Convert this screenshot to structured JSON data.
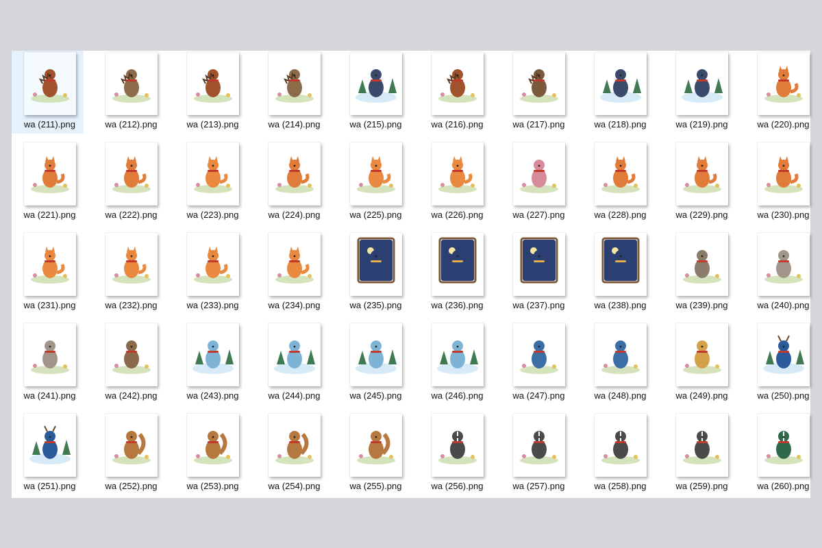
{
  "explorer": {
    "selected_index": 0,
    "files": [
      {
        "name": "wa (211).png",
        "icon": "hedgehog-icon",
        "color": "#a0522d"
      },
      {
        "name": "wa (212).png",
        "icon": "hedgehog-icon",
        "color": "#8b6b4a"
      },
      {
        "name": "wa (213).png",
        "icon": "hedgehog-icon",
        "color": "#a0522d"
      },
      {
        "name": "wa (214).png",
        "icon": "hedgehog-icon",
        "color": "#8b6b4a"
      },
      {
        "name": "wa (215).png",
        "icon": "penguin-icon",
        "color": "#3a4a6b"
      },
      {
        "name": "wa (216).png",
        "icon": "hedgehog-icon",
        "color": "#a0522d"
      },
      {
        "name": "wa (217).png",
        "icon": "hedgehog-icon",
        "color": "#7a5a3a"
      },
      {
        "name": "wa (218).png",
        "icon": "penguin-icon",
        "color": "#3a4a6b"
      },
      {
        "name": "wa (219).png",
        "icon": "penguin-icon",
        "color": "#3a4a6b"
      },
      {
        "name": "wa (220).png",
        "icon": "fox-icon",
        "color": "#e07b39"
      },
      {
        "name": "wa (221).png",
        "icon": "fox-icon",
        "color": "#e07b39"
      },
      {
        "name": "wa (222).png",
        "icon": "fox-icon",
        "color": "#e07b39"
      },
      {
        "name": "wa (223).png",
        "icon": "fox-icon",
        "color": "#e8893f"
      },
      {
        "name": "wa (224).png",
        "icon": "fox-icon",
        "color": "#e07b39"
      },
      {
        "name": "wa (225).png",
        "icon": "fox-icon",
        "color": "#e8893f"
      },
      {
        "name": "wa (226).png",
        "icon": "fox-icon",
        "color": "#e8893f"
      },
      {
        "name": "wa (227).png",
        "icon": "bear-icon",
        "color": "#d78a9a"
      },
      {
        "name": "wa (228).png",
        "icon": "fox-icon",
        "color": "#e07b39"
      },
      {
        "name": "wa (229).png",
        "icon": "fox-icon",
        "color": "#e07b39"
      },
      {
        "name": "wa (230).png",
        "icon": "fox-icon",
        "color": "#e07b39"
      },
      {
        "name": "wa (231).png",
        "icon": "fox-icon",
        "color": "#e8893f"
      },
      {
        "name": "wa (232).png",
        "icon": "fox-icon",
        "color": "#e8893f"
      },
      {
        "name": "wa (233).png",
        "icon": "fox-icon",
        "color": "#e8893f"
      },
      {
        "name": "wa (234).png",
        "icon": "fox-icon",
        "color": "#e8893f"
      },
      {
        "name": "wa (235).png",
        "icon": "window-night-icon",
        "color": "#2b3f73"
      },
      {
        "name": "wa (236).png",
        "icon": "window-night-icon",
        "color": "#2b3f73"
      },
      {
        "name": "wa (237).png",
        "icon": "window-night-icon",
        "color": "#2b3f73"
      },
      {
        "name": "wa (238).png",
        "icon": "window-night-icon",
        "color": "#2b3f73"
      },
      {
        "name": "wa (239).png",
        "icon": "mouse-icon",
        "color": "#8a7b6a"
      },
      {
        "name": "wa (240).png",
        "icon": "mouse-icon",
        "color": "#a09588"
      },
      {
        "name": "wa (241).png",
        "icon": "mouse-icon",
        "color": "#a09588"
      },
      {
        "name": "wa (242).png",
        "icon": "mouse-icon",
        "color": "#8a6a4a"
      },
      {
        "name": "wa (243).png",
        "icon": "skating-mice-icon",
        "color": "#7fb3d5"
      },
      {
        "name": "wa (244).png",
        "icon": "skating-mice-icon",
        "color": "#7fb3d5"
      },
      {
        "name": "wa (245).png",
        "icon": "skating-mice-icon",
        "color": "#7fb3d5"
      },
      {
        "name": "wa (246).png",
        "icon": "skating-mice-icon",
        "color": "#7fb3d5"
      },
      {
        "name": "wa (247).png",
        "icon": "duck-icon",
        "color": "#3a6ea5"
      },
      {
        "name": "wa (248).png",
        "icon": "duck-icon",
        "color": "#3a6ea5"
      },
      {
        "name": "wa (249).png",
        "icon": "duck-icon",
        "color": "#d4a04a"
      },
      {
        "name": "wa (250).png",
        "icon": "deer-icon",
        "color": "#2b5a9a"
      },
      {
        "name": "wa (251).png",
        "icon": "deer-icon",
        "color": "#2b5a9a"
      },
      {
        "name": "wa (252).png",
        "icon": "squirrel-icon",
        "color": "#b5793f"
      },
      {
        "name": "wa (253).png",
        "icon": "squirrel-icon",
        "color": "#b5793f"
      },
      {
        "name": "wa (254).png",
        "icon": "squirrel-icon",
        "color": "#b5793f"
      },
      {
        "name": "wa (255).png",
        "icon": "squirrel-icon",
        "color": "#b5793f"
      },
      {
        "name": "wa (256).png",
        "icon": "badger-icon",
        "color": "#4a4a4a"
      },
      {
        "name": "wa (257).png",
        "icon": "badger-icon",
        "color": "#4a4a4a"
      },
      {
        "name": "wa (258).png",
        "icon": "badger-icon",
        "color": "#4a4a4a"
      },
      {
        "name": "wa (259).png",
        "icon": "badger-icon",
        "color": "#4a4a4a"
      },
      {
        "name": "wa (260).png",
        "icon": "badger-icon",
        "color": "#2e6a4a"
      }
    ]
  }
}
